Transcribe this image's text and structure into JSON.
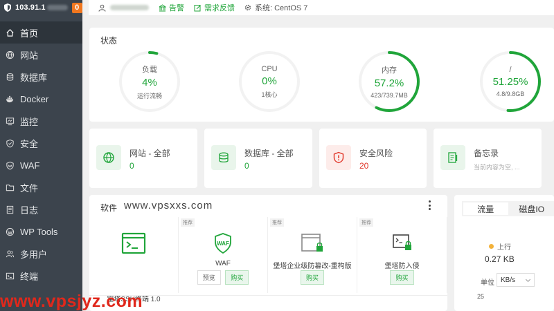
{
  "sidebar": {
    "ip": "103.91.1",
    "badge": "0",
    "items": [
      {
        "label": "首页",
        "icon": "home-icon"
      },
      {
        "label": "网站",
        "icon": "globe-icon"
      },
      {
        "label": "数据库",
        "icon": "database-icon"
      },
      {
        "label": "Docker",
        "icon": "docker-icon"
      },
      {
        "label": "监控",
        "icon": "monitor-icon"
      },
      {
        "label": "安全",
        "icon": "shield-icon"
      },
      {
        "label": "WAF",
        "icon": "waf-shield-icon"
      },
      {
        "label": "文件",
        "icon": "folder-icon"
      },
      {
        "label": "日志",
        "icon": "log-icon"
      },
      {
        "label": "WP Tools",
        "icon": "wordpress-icon"
      },
      {
        "label": "多用户",
        "icon": "users-icon"
      },
      {
        "label": "终端",
        "icon": "terminal-icon"
      }
    ]
  },
  "header": {
    "alert": "告警",
    "feedback": "需求反馈",
    "system": "系统:  CentOS 7"
  },
  "status": {
    "title": "状态",
    "gauges": [
      {
        "label": "负载",
        "value": "4%",
        "sub": "运行流畅",
        "percent": 4
      },
      {
        "label": "CPU",
        "value": "0%",
        "sub": "1核心",
        "percent": 0
      },
      {
        "label": "内存",
        "value": "57.2%",
        "sub": "423/739.7MB",
        "percent": 57.2
      },
      {
        "label": "/",
        "value": "51.25%",
        "sub": "4.8/9.8GB",
        "percent": 51.25
      }
    ]
  },
  "overview": {
    "site": {
      "name": "网站 - 全部",
      "count": "0"
    },
    "database": {
      "name": "数据库 - 全部",
      "count": "0"
    },
    "risk": {
      "name": "安全风险",
      "count": "20"
    },
    "memo": {
      "name": "备忘录",
      "note": "当前内容为空, ..."
    }
  },
  "software": {
    "title": "软件",
    "watermark": "www.vpsxxs.com",
    "apps": [
      {
        "name": "宝塔SSH终端 1.0",
        "tag": ""
      },
      {
        "name": "WAF",
        "tag": "推荐",
        "btn1": "预览",
        "btn2": "购买"
      },
      {
        "name": "堡塔企业级防篡改-重构版",
        "tag": "推荐",
        "btn2": "购买"
      },
      {
        "name": "堡塔防入侵",
        "tag": "推荐",
        "btn2": "购买"
      }
    ]
  },
  "traffic": {
    "tab1": "流量",
    "tab2": "磁盘IO",
    "up_label": "上行",
    "up_value": "0.27 KB",
    "unit_label": "单位",
    "unit_value": "KB/s",
    "y_tick": "25"
  },
  "watermark": "www.vpsjyz.com",
  "colors": {
    "accent": "#20a53a",
    "sidebar": "#3c444d",
    "danger": "#e13528",
    "badge": "#f0771f"
  }
}
